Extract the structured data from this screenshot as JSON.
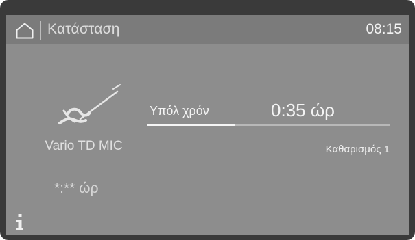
{
  "header": {
    "title": "Κατάσταση",
    "time": "08:15"
  },
  "program": {
    "name": "Vario TD MIC",
    "icon": "instrument-icon",
    "total_time": "*:** ώρ"
  },
  "status": {
    "remaining_label": "Υπόλ χρόν",
    "remaining_value": "0:35  ώρ",
    "phase": "Καθαρισμός 1",
    "progress_fraction": 0.36
  },
  "footer": {
    "info_icon": "info-icon"
  },
  "colors": {
    "screen_bg": "#8d8d8d",
    "header_bg": "#7b7b7b",
    "text": "#f4f4f4",
    "progress_fill": "#f5f5f5",
    "progress_track": "#b8b8b8"
  }
}
